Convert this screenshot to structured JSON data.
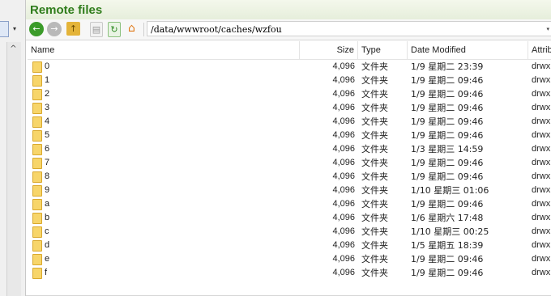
{
  "title": "Remote files",
  "toolbar": {
    "path": "/data/wwwroot/caches/wzfou",
    "back_glyph": "←",
    "forward_glyph": "→",
    "up_glyph": "↑",
    "refresh_glyph": "↻",
    "home_glyph": "⌂",
    "file_glyph": "▤"
  },
  "columns": {
    "name": "Name",
    "size": "Size",
    "type": "Type",
    "date": "Date Modified",
    "attr": "Attributes"
  },
  "rows": [
    {
      "name": "0",
      "size": "4,096",
      "type": "文件夹",
      "date": "1/9 星期二 23:39",
      "attr": "drwx"
    },
    {
      "name": "1",
      "size": "4,096",
      "type": "文件夹",
      "date": "1/9 星期二 09:46",
      "attr": "drwx"
    },
    {
      "name": "2",
      "size": "4,096",
      "type": "文件夹",
      "date": "1/9 星期二 09:46",
      "attr": "drwx"
    },
    {
      "name": "3",
      "size": "4,096",
      "type": "文件夹",
      "date": "1/9 星期二 09:46",
      "attr": "drwx"
    },
    {
      "name": "4",
      "size": "4,096",
      "type": "文件夹",
      "date": "1/9 星期二 09:46",
      "attr": "drwx"
    },
    {
      "name": "5",
      "size": "4,096",
      "type": "文件夹",
      "date": "1/9 星期二 09:46",
      "attr": "drwx"
    },
    {
      "name": "6",
      "size": "4,096",
      "type": "文件夹",
      "date": "1/3 星期三 14:59",
      "attr": "drwx"
    },
    {
      "name": "7",
      "size": "4,096",
      "type": "文件夹",
      "date": "1/9 星期二 09:46",
      "attr": "drwx"
    },
    {
      "name": "8",
      "size": "4,096",
      "type": "文件夹",
      "date": "1/9 星期二 09:46",
      "attr": "drwx"
    },
    {
      "name": "9",
      "size": "4,096",
      "type": "文件夹",
      "date": "1/10 星期三 01:06",
      "attr": "drwx"
    },
    {
      "name": "a",
      "size": "4,096",
      "type": "文件夹",
      "date": "1/9 星期二 09:46",
      "attr": "drwx"
    },
    {
      "name": "b",
      "size": "4,096",
      "type": "文件夹",
      "date": "1/6 星期六 17:48",
      "attr": "drwx"
    },
    {
      "name": "c",
      "size": "4,096",
      "type": "文件夹",
      "date": "1/10 星期三 00:25",
      "attr": "drwx"
    },
    {
      "name": "d",
      "size": "4,096",
      "type": "文件夹",
      "date": "1/5 星期五 18:39",
      "attr": "drwx"
    },
    {
      "name": "e",
      "size": "4,096",
      "type": "文件夹",
      "date": "1/9 星期二 09:46",
      "attr": "drwx"
    },
    {
      "name": "f",
      "size": "4,096",
      "type": "文件夹",
      "date": "1/9 星期二 09:46",
      "attr": "drwx"
    }
  ],
  "left_pane": {
    "scroll_up_glyph": "^",
    "dropdown_glyph": "▾"
  },
  "path_dropdown_glyph": "▾"
}
